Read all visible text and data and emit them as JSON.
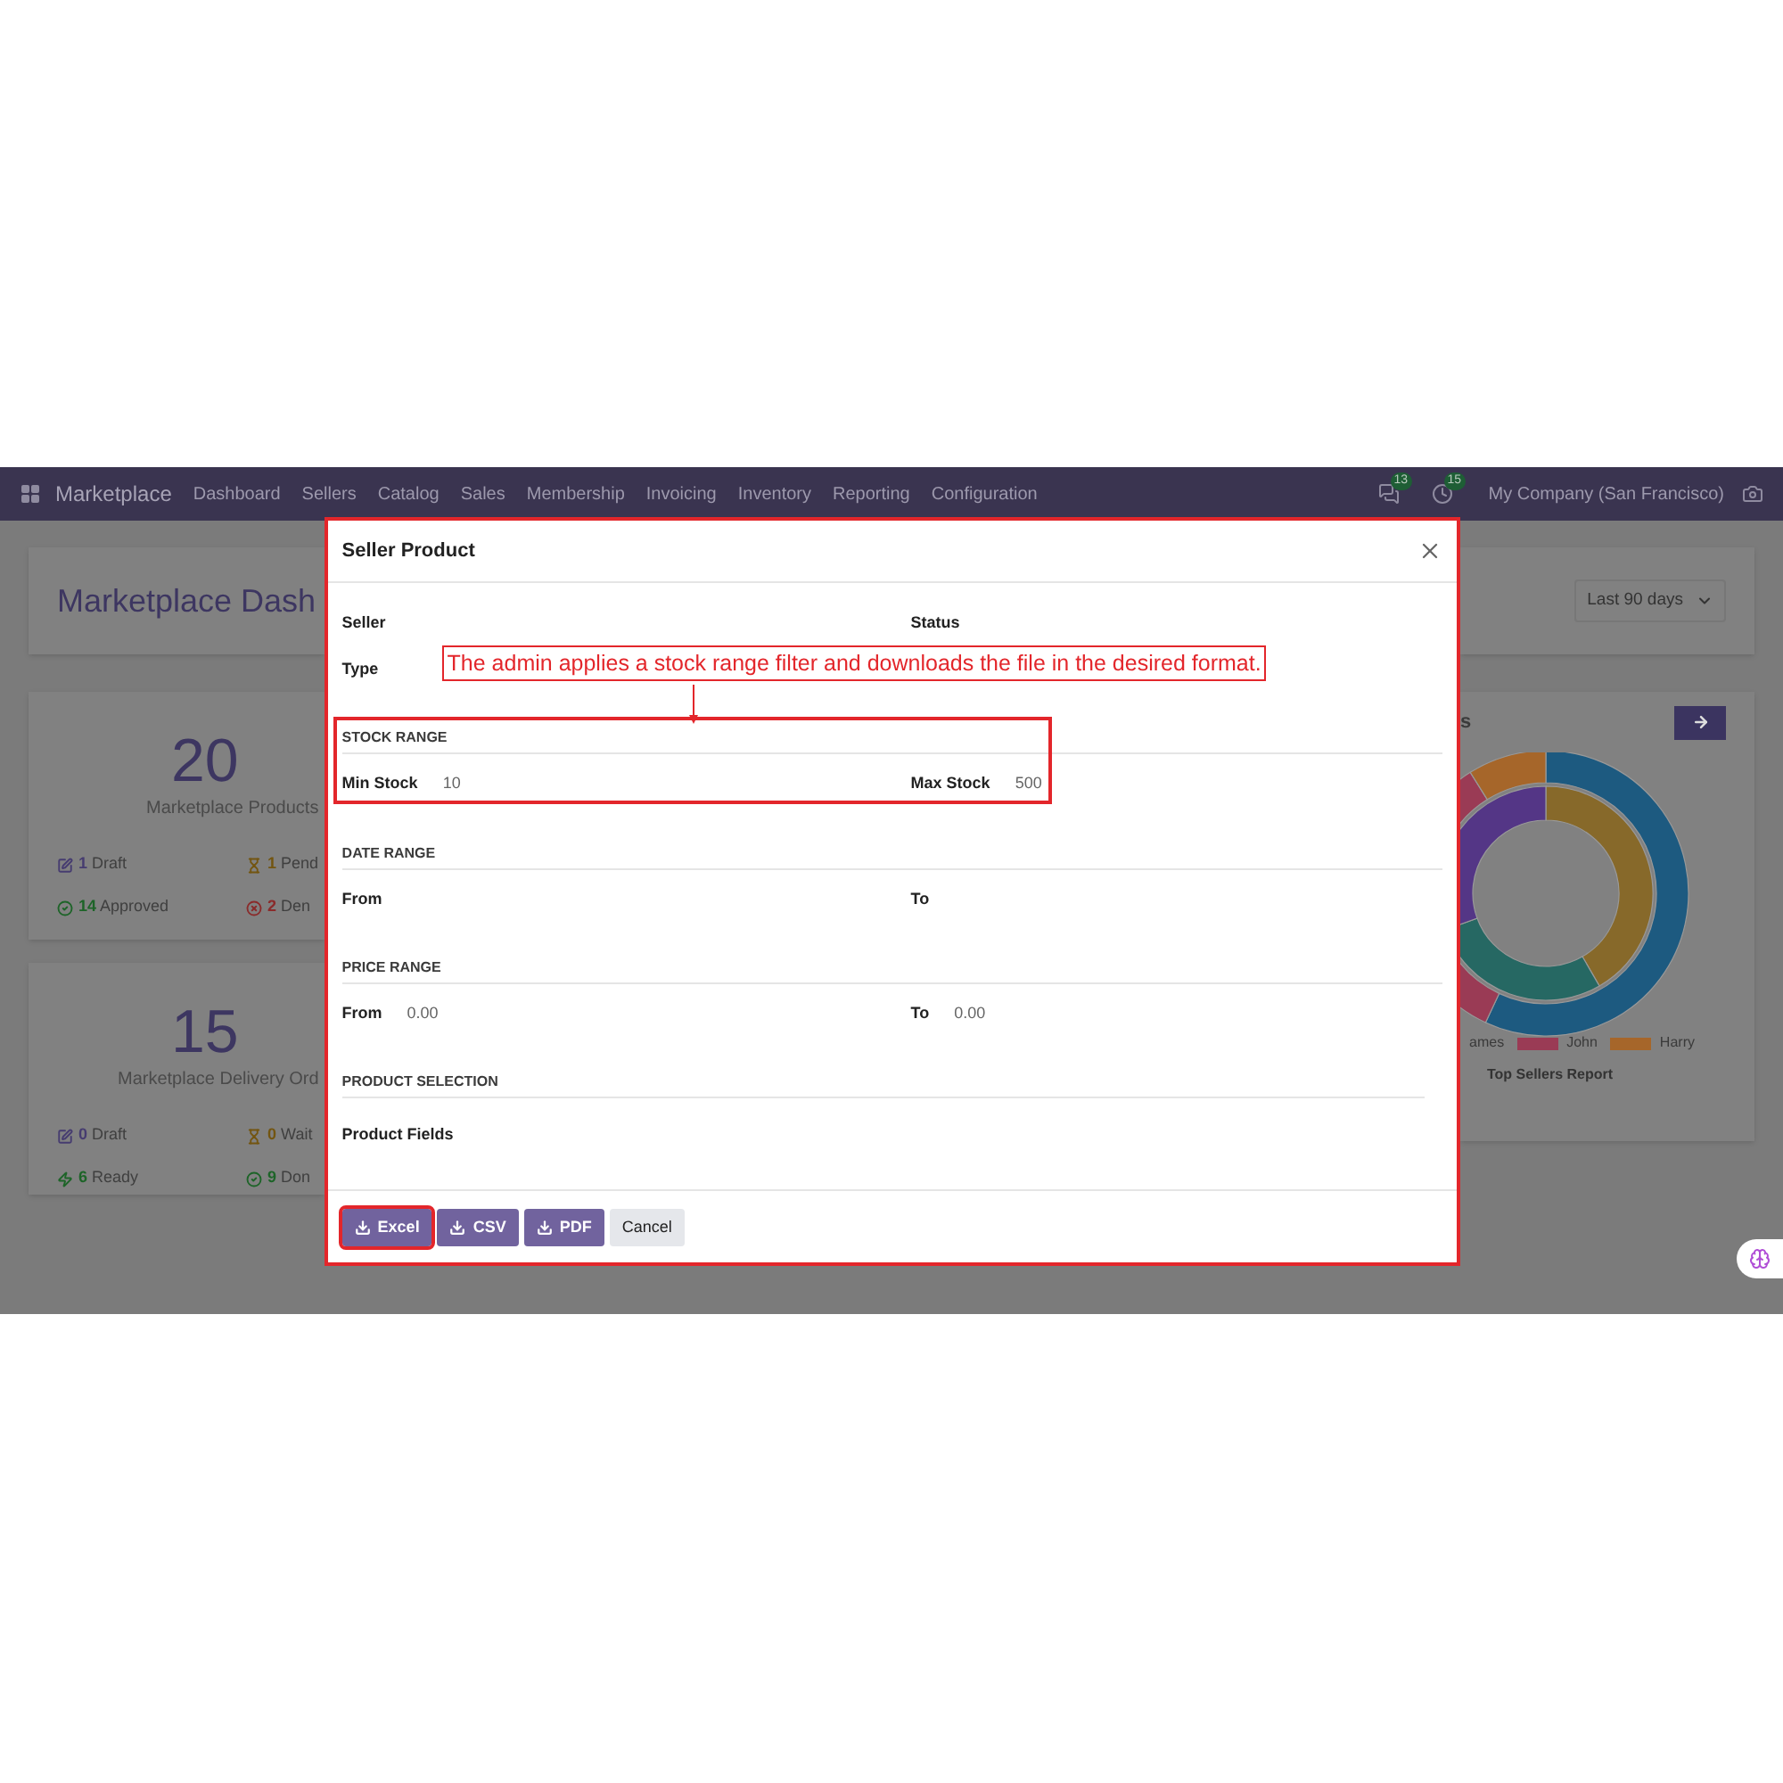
{
  "navbar": {
    "app_name": "Marketplace",
    "menu": [
      "Dashboard",
      "Sellers",
      "Catalog",
      "Sales",
      "Membership",
      "Invoicing",
      "Inventory",
      "Reporting",
      "Configuration"
    ],
    "messages_count": "13",
    "activities_count": "15",
    "company": "My Company (San Francisco)"
  },
  "dashboard": {
    "title": "Marketplace Dash",
    "period": "Last 90 days",
    "cards": [
      {
        "count": "20",
        "label": "Marketplace Products",
        "stats": [
          {
            "kind": "draft",
            "count": "1",
            "label": "Draft"
          },
          {
            "kind": "pending",
            "count": "1",
            "label": "Pend"
          },
          {
            "kind": "approved",
            "count": "14",
            "label": "Approved"
          },
          {
            "kind": "denied",
            "count": "2",
            "label": "Den"
          }
        ]
      },
      {
        "count": "15",
        "label": "Marketplace Delivery Ord",
        "stats": [
          {
            "kind": "draft",
            "count": "0",
            "label": "Draft"
          },
          {
            "kind": "pending",
            "count": "0",
            "label": "Wait"
          },
          {
            "kind": "ready",
            "count": "6",
            "label": "Ready"
          },
          {
            "kind": "approved",
            "count": "9",
            "label": "Don"
          }
        ]
      }
    ],
    "chart_card": {
      "title": "s",
      "legend": [
        {
          "label": "ames"
        },
        {
          "label": "John",
          "color": "#9a3b55"
        },
        {
          "label": "Harry",
          "color": "#a6662a"
        }
      ],
      "caption": "Top Sellers Report"
    }
  },
  "modal": {
    "title": "Seller Product",
    "fields": [
      {
        "label": "Seller"
      },
      {
        "label": "Status"
      },
      {
        "label": "Type"
      }
    ],
    "annotation": "The admin applies a stock range filter and downloads the file in the desired format.",
    "sections": [
      {
        "heading": "STOCK RANGE",
        "highlighted": true,
        "fields": [
          {
            "label": "Min Stock",
            "value": "10"
          },
          {
            "label": "Max Stock",
            "value": "500"
          }
        ]
      },
      {
        "heading": "DATE RANGE",
        "highlighted": false,
        "fields": [
          {
            "label": "From"
          },
          {
            "label": "To"
          }
        ]
      },
      {
        "heading": "PRICE RANGE",
        "highlighted": false,
        "fields": [
          {
            "label": "From",
            "value": "0.00"
          },
          {
            "label": "To",
            "value": "0.00"
          }
        ]
      },
      {
        "heading": "PRODUCT SELECTION",
        "highlighted": false,
        "fields": [
          {
            "label": "Product Fields"
          }
        ]
      }
    ],
    "buttons": [
      {
        "label": "Excel",
        "kind": "download",
        "highlighted": true
      },
      {
        "label": "CSV",
        "kind": "download",
        "highlighted": false
      },
      {
        "label": "PDF",
        "kind": "download",
        "highlighted": false
      },
      {
        "label": "Cancel",
        "kind": "secondary",
        "highlighted": false
      }
    ]
  }
}
